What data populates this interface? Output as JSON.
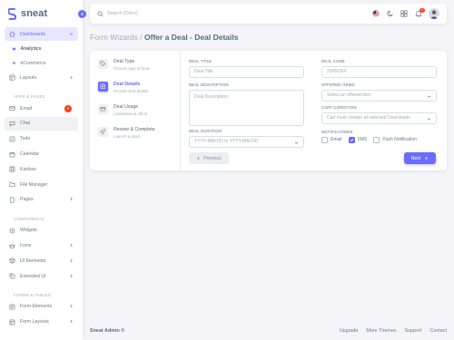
{
  "brand": {
    "name": "sneat"
  },
  "sidebar": {
    "items_top": [
      {
        "label": "Dashboards",
        "icon": "home-icon",
        "open": true
      }
    ],
    "dashboard_sub": [
      {
        "label": "Analytics",
        "active": true
      },
      {
        "label": "eCommerce",
        "active": false
      }
    ],
    "layouts": {
      "label": "Layouts"
    },
    "header_apps": "APPS & PAGES",
    "apps": [
      {
        "label": "Email",
        "icon": "mail-icon",
        "badge": "4"
      },
      {
        "label": "Chat",
        "icon": "chat-icon"
      },
      {
        "label": "Todo",
        "icon": "check-square-icon"
      },
      {
        "label": "Calendar",
        "icon": "calendar-icon"
      },
      {
        "label": "Kanban",
        "icon": "grid-icon"
      },
      {
        "label": "File Manager",
        "icon": "folder-icon"
      },
      {
        "label": "Pages",
        "icon": "file-icon",
        "chevron": true
      }
    ],
    "header_components": "COMPONENTS",
    "components": [
      {
        "label": "Widgets",
        "icon": "widgets-icon"
      },
      {
        "label": "Icons",
        "icon": "crown-icon",
        "chevron": true
      },
      {
        "label": "UI Elements",
        "icon": "box-icon",
        "chevron": true
      },
      {
        "label": "Extended UI",
        "icon": "copy-icon",
        "chevron": true
      }
    ],
    "header_forms": "FORMS & TABLES",
    "forms": [
      {
        "label": "Form Elements",
        "icon": "detail-icon",
        "chevron": true
      },
      {
        "label": "Form Layouts",
        "icon": "layout-icon",
        "chevron": true
      }
    ]
  },
  "navbar": {
    "search_placeholder": "Search (Ctrl+/)",
    "notification_count": "4"
  },
  "page": {
    "breadcrumb": "Form Wizards /",
    "title": "Offer a Deal - Deal Details"
  },
  "wizard": {
    "steps": [
      {
        "title": "Deal Type",
        "subtitle": "Choose type of deal",
        "icon": "tag-icon",
        "active": false
      },
      {
        "title": "Deal Details",
        "subtitle": "Provide deal details",
        "icon": "detail-icon",
        "active": true
      },
      {
        "title": "Deal Usage",
        "subtitle": "Limitations & offers",
        "icon": "credit-card-icon",
        "active": false
      },
      {
        "title": "Review & Complete",
        "subtitle": "Launch a deal!",
        "icon": "rocket-icon",
        "active": false
      }
    ],
    "fields": {
      "deal_title": {
        "label": "DEAL TITLE",
        "placeholder": "Deal Title"
      },
      "deal_code": {
        "label": "DEAL CODE",
        "placeholder": "25PEOFF"
      },
      "deal_description": {
        "label": "DEAL DESCRIPTION",
        "placeholder": "Deal Description"
      },
      "offered_items": {
        "label": "OFFERED ITEMS",
        "placeholder": "Select an offered item"
      },
      "cart_condition": {
        "label": "CART CONDITION",
        "placeholder": "Cart must contain all selected Downloads"
      },
      "deal_duration": {
        "label": "DEAL DURATION",
        "placeholder": "YYYY-MM-DD to YYYY-MM-DD"
      },
      "notifications": {
        "label": "NOTIFICATIONS",
        "options": [
          {
            "label": "Email",
            "checked": false
          },
          {
            "label": "SMS",
            "checked": true
          },
          {
            "label": "Push Notification",
            "checked": false
          }
        ]
      }
    },
    "buttons": {
      "previous": "Previous",
      "next": "Next"
    }
  },
  "footer": {
    "brand": "Sneat Admin ©",
    "links": [
      "Upgrade",
      "More Themes",
      "Support",
      "Contact"
    ]
  },
  "colors": {
    "primary": "#696cff",
    "danger": "#ff3e1d",
    "heading": "#566a7f",
    "text": "#697a8d",
    "muted": "#a1acb8"
  }
}
